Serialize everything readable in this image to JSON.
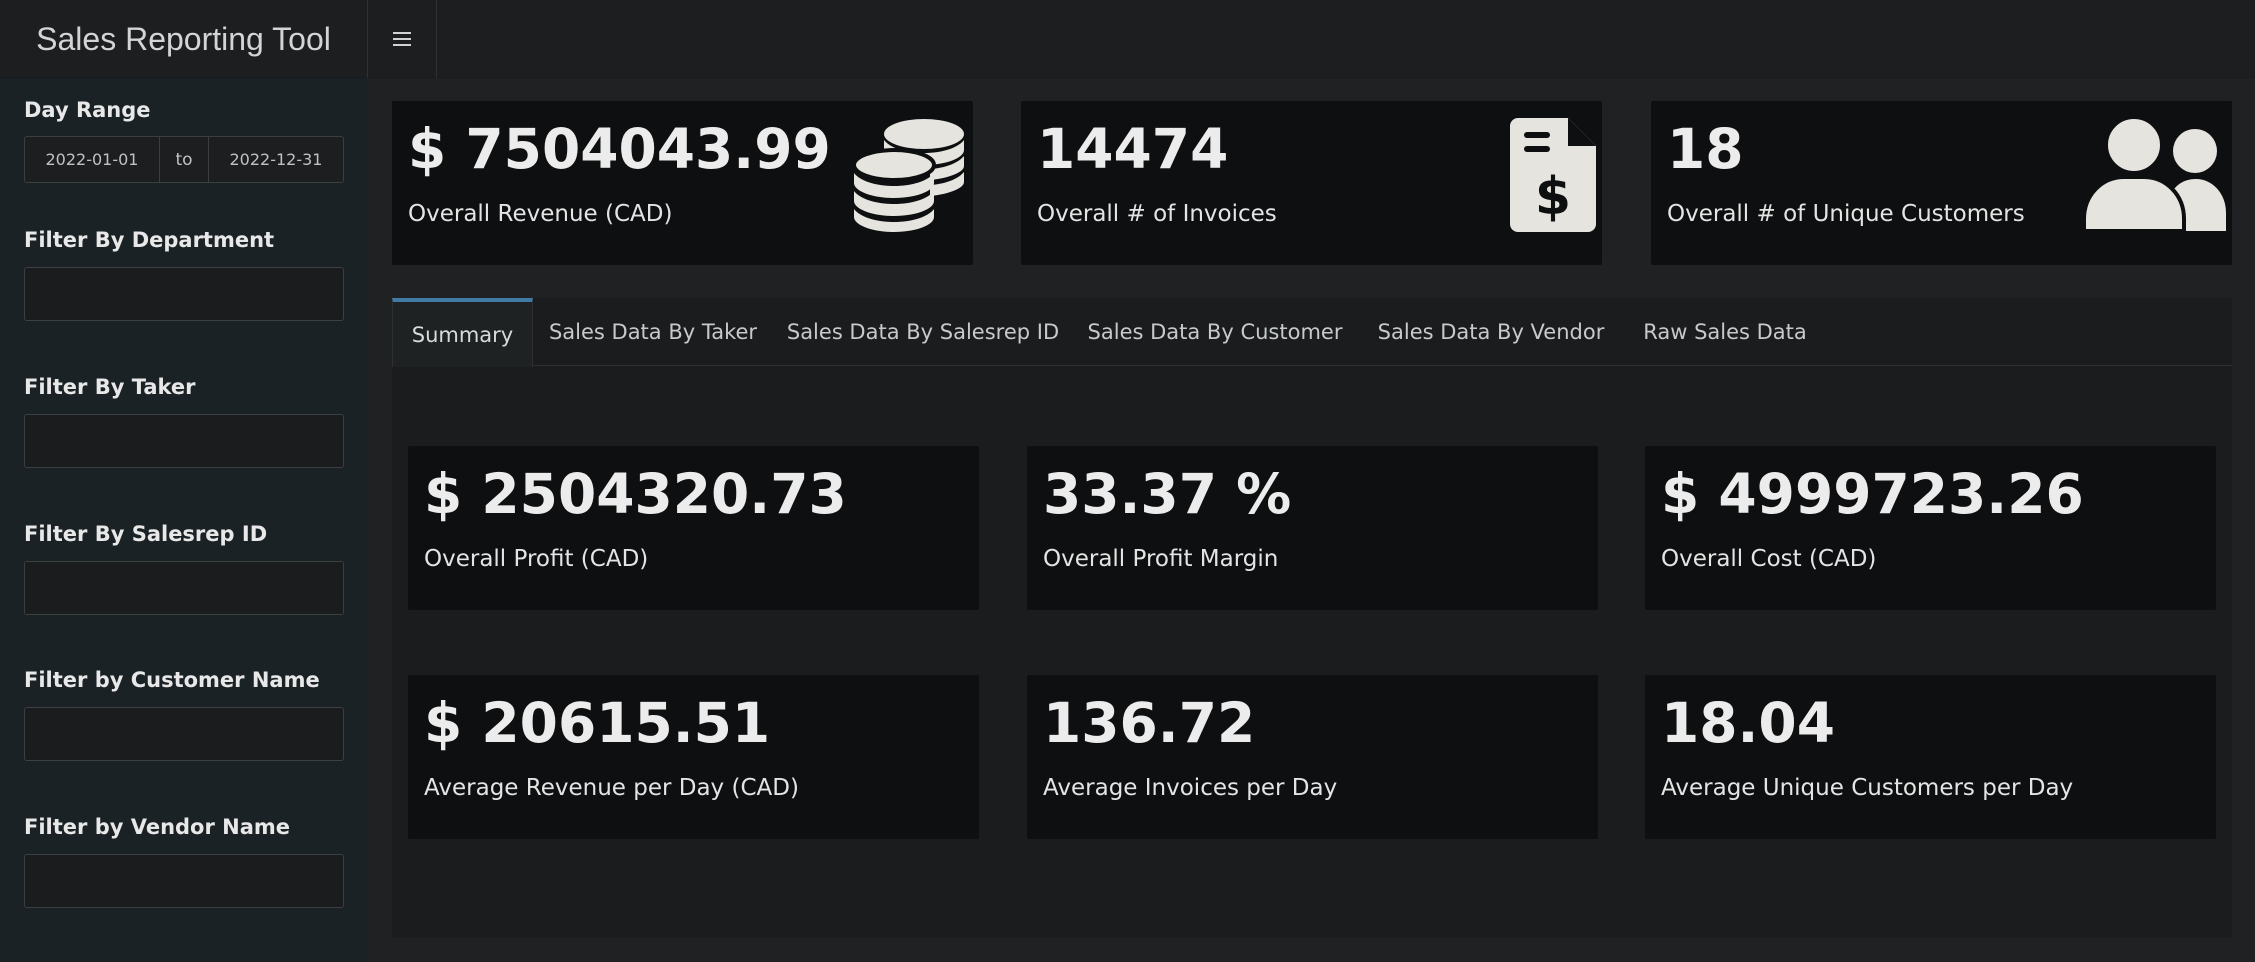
{
  "app": {
    "title": "Sales Reporting Tool",
    "menu_icon": "hamburger-icon"
  },
  "sidebar": {
    "day_range": {
      "label": "Day Range",
      "start": "2022-01-01",
      "separator": "to",
      "end": "2022-12-31"
    },
    "filters": [
      {
        "label": "Filter By Department",
        "value": ""
      },
      {
        "label": "Filter By Taker",
        "value": ""
      },
      {
        "label": "Filter By Salesrep ID",
        "value": ""
      },
      {
        "label": "Filter by Customer Name",
        "value": ""
      },
      {
        "label": "Filter by Vendor Name",
        "value": ""
      }
    ]
  },
  "top_boxes": [
    {
      "value": "$ 7504043.99",
      "label": "Overall Revenue (CAD)",
      "icon": "coins-icon"
    },
    {
      "value": "14474",
      "label": "Overall # of Invoices",
      "icon": "invoice-dollar-icon"
    },
    {
      "value": "18",
      "label": "Overall # of Unique Customers",
      "icon": "users-icon"
    }
  ],
  "tabs": [
    {
      "label": "Summary",
      "active": true
    },
    {
      "label": "Sales Data By Taker",
      "active": false
    },
    {
      "label": "Sales Data By Salesrep ID",
      "active": false
    },
    {
      "label": "Sales Data By Customer",
      "active": false
    },
    {
      "label": "Sales Data By Vendor",
      "active": false
    },
    {
      "label": "Raw Sales Data",
      "active": false
    }
  ],
  "summary_boxes": [
    {
      "value": "$ 2504320.73",
      "label": "Overall Profit (CAD)"
    },
    {
      "value": "33.37 %",
      "label": "Overall Profit Margin"
    },
    {
      "value": "$ 4999723.26",
      "label": "Overall Cost (CAD)"
    },
    {
      "value": "$ 20615.51",
      "label": "Average Revenue per Day (CAD)"
    },
    {
      "value": "136.72",
      "label": "Average Invoices per Day"
    },
    {
      "value": "18.04",
      "label": "Average Unique Customers per Day"
    }
  ],
  "colors": {
    "accent": "#3f7ba3",
    "box_bg": "#0e0f10",
    "sidebar_bg": "#1b2226"
  }
}
